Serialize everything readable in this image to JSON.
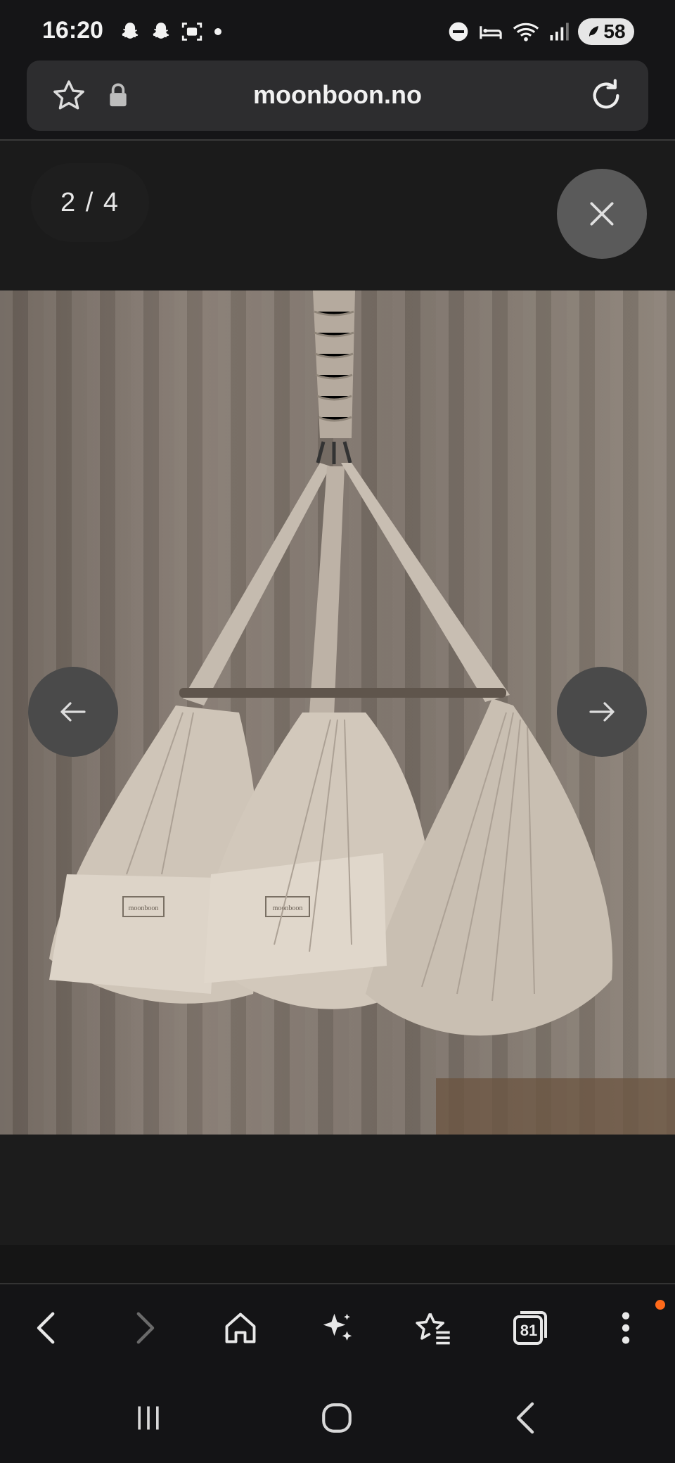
{
  "status_bar": {
    "time": "16:20",
    "battery": "58",
    "left_icons": [
      "snapchat-icon",
      "snapchat-icon",
      "screenshot-icon",
      "dot-icon"
    ],
    "right_icons": [
      "dnd-icon",
      "sleep-icon",
      "wifi-icon",
      "signal-icon",
      "battery-icon"
    ]
  },
  "browser": {
    "url": "moonboon.no"
  },
  "lightbox": {
    "counter": "2 / 4",
    "image": {
      "subject": "hanging baby hammock cradle",
      "label_text": "moonboon"
    }
  },
  "toolbar": {
    "items": [
      "back-icon",
      "forward-icon",
      "home-icon",
      "ai-sparkle-icon",
      "bookmarks-icon",
      "tabs-icon",
      "menu-icon"
    ],
    "tabs_count": "81",
    "notification_color": "#ff6a1a"
  },
  "system_nav": [
    "recents-icon",
    "home-icon",
    "back-icon"
  ]
}
